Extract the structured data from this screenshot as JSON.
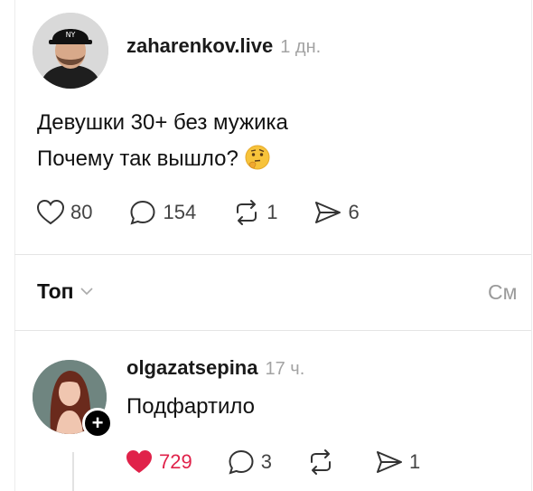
{
  "post": {
    "username": "zaharenkov.live",
    "time": "1 дн.",
    "lines": [
      "Девушки 30+ без мужика",
      "Почему так вышло?"
    ],
    "emoji_icon": "thinking-face-emoji",
    "stats": {
      "likes": "80",
      "comments": "154",
      "reposts": "1",
      "shares": "6"
    }
  },
  "replies": {
    "sort_label": "Топ",
    "see_label": "См"
  },
  "comment": {
    "username": "olgazatsepina",
    "time": "17 ч.",
    "text": "Подфартило",
    "follow_icon": "+",
    "stats": {
      "likes": "729",
      "comments": "3",
      "reposts": "",
      "shares": "1"
    }
  },
  "colors": {
    "like_active": "#e0224a",
    "muted": "#a3a3a3",
    "text": "#111111"
  }
}
